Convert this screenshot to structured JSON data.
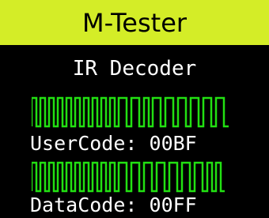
{
  "header": {
    "title": "M-Tester",
    "background_color": "#d4ed27"
  },
  "mode": {
    "label": "IR Decoder"
  },
  "readouts": [
    {
      "label": "UserCode:",
      "value": "00BF"
    },
    {
      "label": "DataCode:",
      "value": "00FF"
    }
  ],
  "waveform_color": "#22e012"
}
